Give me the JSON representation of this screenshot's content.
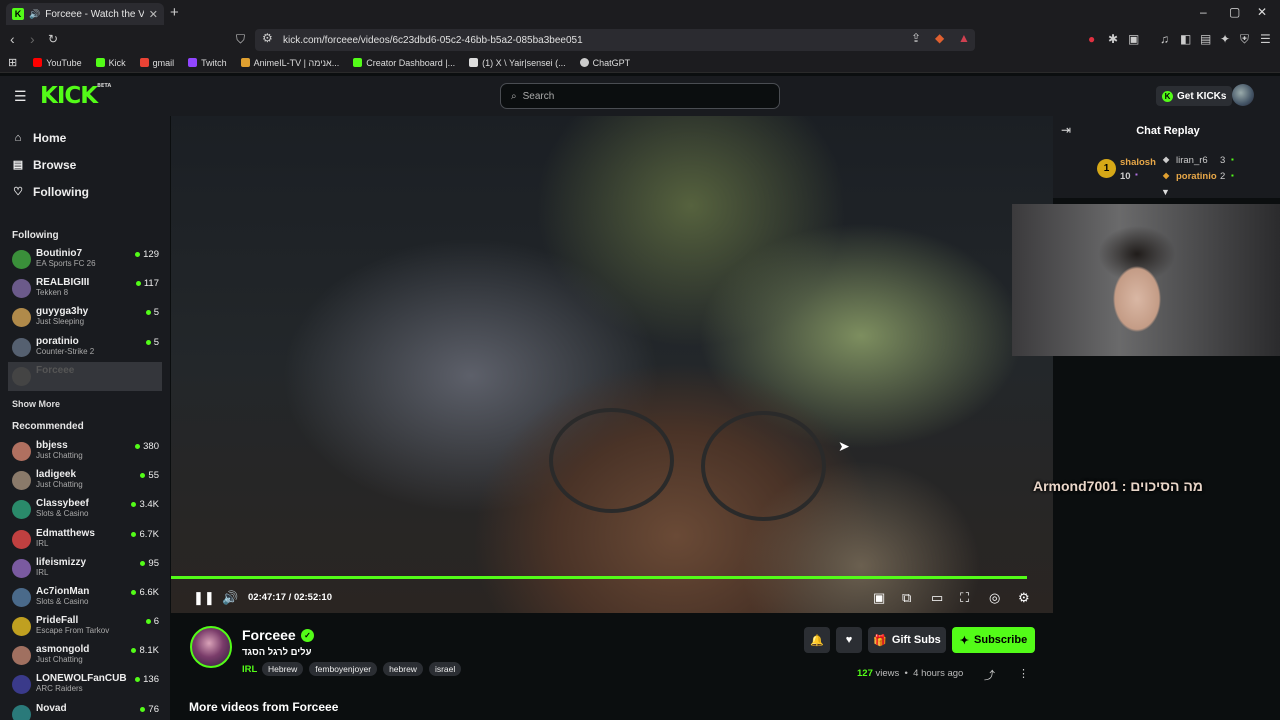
{
  "browser": {
    "tab_title": "Forceee - Watch the VOD on",
    "url": "kick.com/forceee/videos/6c23dbd6-05c2-46bb-b5a2-085ba3bee051",
    "bookmarks": [
      {
        "label": "YouTube",
        "color": "#ff0000"
      },
      {
        "label": "Kick",
        "color": "#53fc18"
      },
      {
        "label": "gmail",
        "color": "#ea4335"
      },
      {
        "label": "Twitch",
        "color": "#9146ff"
      },
      {
        "label": "AnimeIL-TV | אנימה...",
        "color": "#e0a030"
      },
      {
        "label": "Creator Dashboard |...",
        "color": "#53fc18"
      },
      {
        "label": "(1) X \\ Yair|sensei (...",
        "color": "#dddddd"
      },
      {
        "label": "ChatGPT",
        "color": "#cccccc"
      }
    ]
  },
  "header": {
    "logo": "KICK",
    "logo_badge": "BETA",
    "search_placeholder": "Search",
    "get_kicks": "Get KICKs"
  },
  "sidebar": {
    "nav": [
      {
        "label": "Home",
        "icon": "home-icon"
      },
      {
        "label": "Browse",
        "icon": "browse-icon"
      },
      {
        "label": "Following",
        "icon": "heart-icon"
      }
    ],
    "following_heading": "Following",
    "following": [
      {
        "name": "Boutinio7",
        "category": "EA Sports FC 26",
        "viewers": "129",
        "color": "#3a8f3a"
      },
      {
        "name": "REALBIGIII",
        "category": "Tekken 8",
        "viewers": "117",
        "color": "#6b5a8a"
      },
      {
        "name": "guyyga3hy",
        "category": "Just Sleeping",
        "viewers": "5",
        "color": "#b08a4a"
      },
      {
        "name": "poratinio",
        "category": "Counter-Strike 2",
        "viewers": "5",
        "color": "#556070"
      },
      {
        "name": "Forceee",
        "category": "",
        "viewers": "",
        "color": "#444"
      }
    ],
    "show_more": "Show More",
    "recommended_heading": "Recommended",
    "recommended": [
      {
        "name": "bbjess",
        "category": "Just Chatting",
        "viewers": "380",
        "color": "#b07060"
      },
      {
        "name": "ladigeek",
        "category": "Just Chatting",
        "viewers": "55",
        "color": "#8a7a6a"
      },
      {
        "name": "Classybeef",
        "category": "Slots & Casino",
        "viewers": "3.4K",
        "color": "#2a8a6a"
      },
      {
        "name": "Edmatthews",
        "category": "IRL",
        "viewers": "6.7K",
        "color": "#c04040"
      },
      {
        "name": "lifeismizzy",
        "category": "IRL",
        "viewers": "95",
        "color": "#7a5aa0"
      },
      {
        "name": "Ac7ionMan",
        "category": "Slots & Casino",
        "viewers": "6.6K",
        "color": "#4a6a8a"
      },
      {
        "name": "PrideFall",
        "category": "Escape From Tarkov",
        "viewers": "6",
        "color": "#c0a020"
      },
      {
        "name": "asmongold",
        "category": "Just Chatting",
        "viewers": "8.1K",
        "color": "#a07060"
      },
      {
        "name": "LONEWOLFanCUB",
        "category": "ARC Raiders",
        "viewers": "136",
        "color": "#3a3a8a"
      },
      {
        "name": "Novad",
        "category": "",
        "viewers": "76",
        "color": "#2a7a7a"
      }
    ]
  },
  "player": {
    "current_time": "02:47:17",
    "separator": "/",
    "duration": "02:52:10",
    "progress": 0.97
  },
  "chat": {
    "title": "Chat Replay",
    "leader_rank": "1",
    "leader_name": "shalosh",
    "leader_count": "10",
    "second_name": "liran_r6",
    "second_count": "3",
    "third_name": "poratinio",
    "third_count": "2",
    "overlay_message": "Armond7001 : מה הסיכוים"
  },
  "channel": {
    "name": "Forceee",
    "vod_title": "עלים לרגל הסגד",
    "category": "IRL",
    "tags": [
      "Hebrew",
      "femboyenjoyer",
      "hebrew",
      "israel"
    ],
    "gift_subs": "Gift Subs",
    "subscribe": "Subscribe",
    "views_count": "127",
    "views_label": "views",
    "bullet": "•",
    "time_ago": "4 hours ago",
    "more_videos": "More videos from Forceee"
  },
  "colors": {
    "accent": "#53fc18",
    "background": "#0b0e0f",
    "surface": "#191b1f"
  }
}
